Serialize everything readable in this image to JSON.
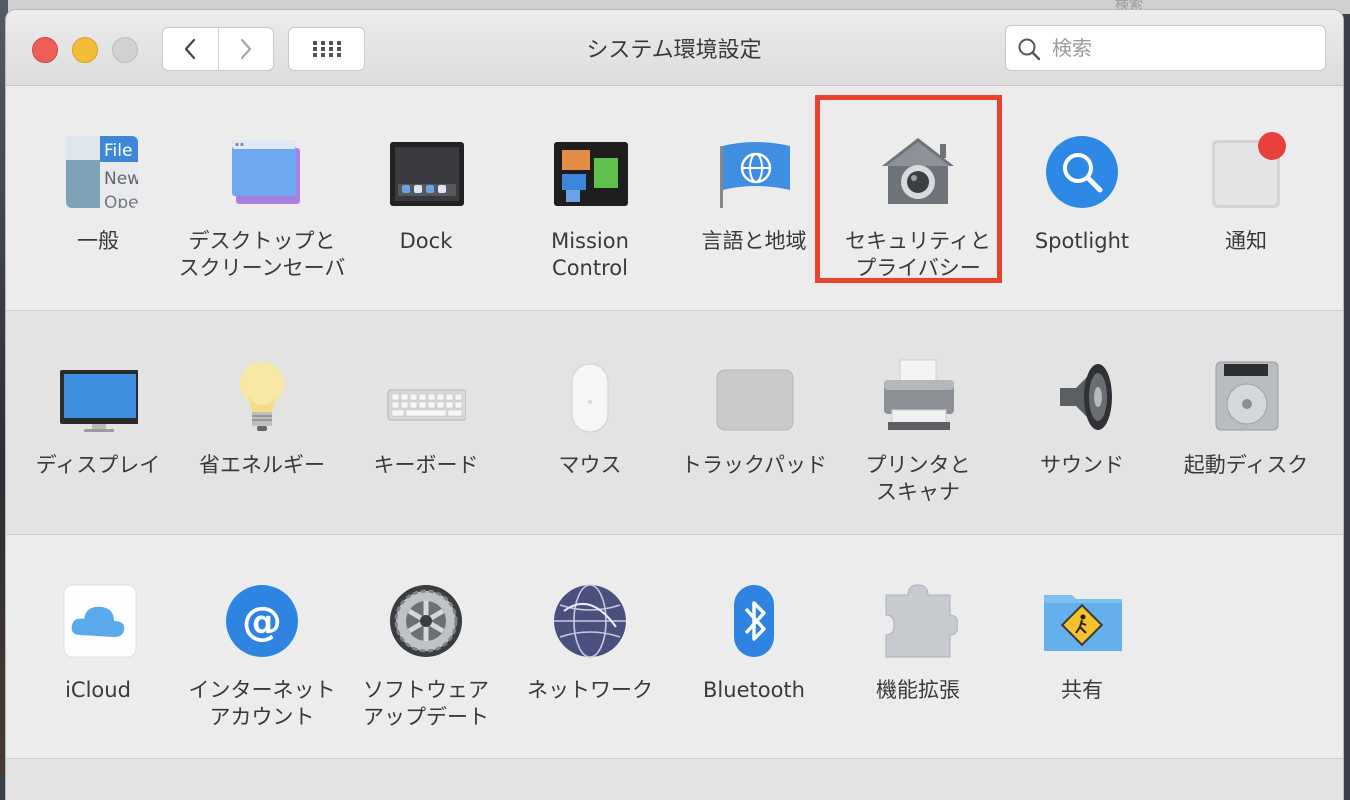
{
  "window": {
    "title": "システム環境設定",
    "search_placeholder": "検索"
  },
  "background_ghost": {
    "search_label": "検索"
  },
  "accent_colors": {
    "highlight": "#e8412c",
    "close": "#ee5e57",
    "minimize": "#f4bd38",
    "badge": "#e8413b"
  },
  "rows": [
    {
      "panes": [
        {
          "label": "一般",
          "icon": "general-icon"
        },
        {
          "label": "デスクトップと\nスクリーンセーバ",
          "icon": "desktop-screensaver-icon"
        },
        {
          "label": "Dock",
          "icon": "dock-icon"
        },
        {
          "label": "Mission\nControl",
          "icon": "mission-control-icon"
        },
        {
          "label": "言語と地域",
          "icon": "language-region-icon"
        },
        {
          "label": "セキュリティと\nプライバシー",
          "icon": "security-privacy-icon"
        },
        {
          "label": "Spotlight",
          "icon": "spotlight-icon"
        },
        {
          "label": "通知",
          "icon": "notifications-icon"
        }
      ]
    },
    {
      "panes": [
        {
          "label": "ディスプレイ",
          "icon": "display-icon"
        },
        {
          "label": "省エネルギー",
          "icon": "energy-saver-icon"
        },
        {
          "label": "キーボード",
          "icon": "keyboard-icon"
        },
        {
          "label": "マウス",
          "icon": "mouse-icon"
        },
        {
          "label": "トラックパッド",
          "icon": "trackpad-icon"
        },
        {
          "label": "プリンタと\nスキャナ",
          "icon": "printer-scanner-icon"
        },
        {
          "label": "サウンド",
          "icon": "sound-icon"
        },
        {
          "label": "起動ディスク",
          "icon": "startup-disk-icon"
        }
      ]
    },
    {
      "panes": [
        {
          "label": "iCloud",
          "icon": "icloud-icon"
        },
        {
          "label": "インターネット\nアカウント",
          "icon": "internet-accounts-icon"
        },
        {
          "label": "ソフトウェア\nアップデート",
          "icon": "software-update-icon"
        },
        {
          "label": "ネットワーク",
          "icon": "network-icon"
        },
        {
          "label": "Bluetooth",
          "icon": "bluetooth-icon"
        },
        {
          "label": "機能拡張",
          "icon": "extensions-icon"
        },
        {
          "label": "共有",
          "icon": "sharing-icon"
        }
      ]
    }
  ],
  "general_icon_text": [
    "File",
    "New",
    "Ope"
  ]
}
